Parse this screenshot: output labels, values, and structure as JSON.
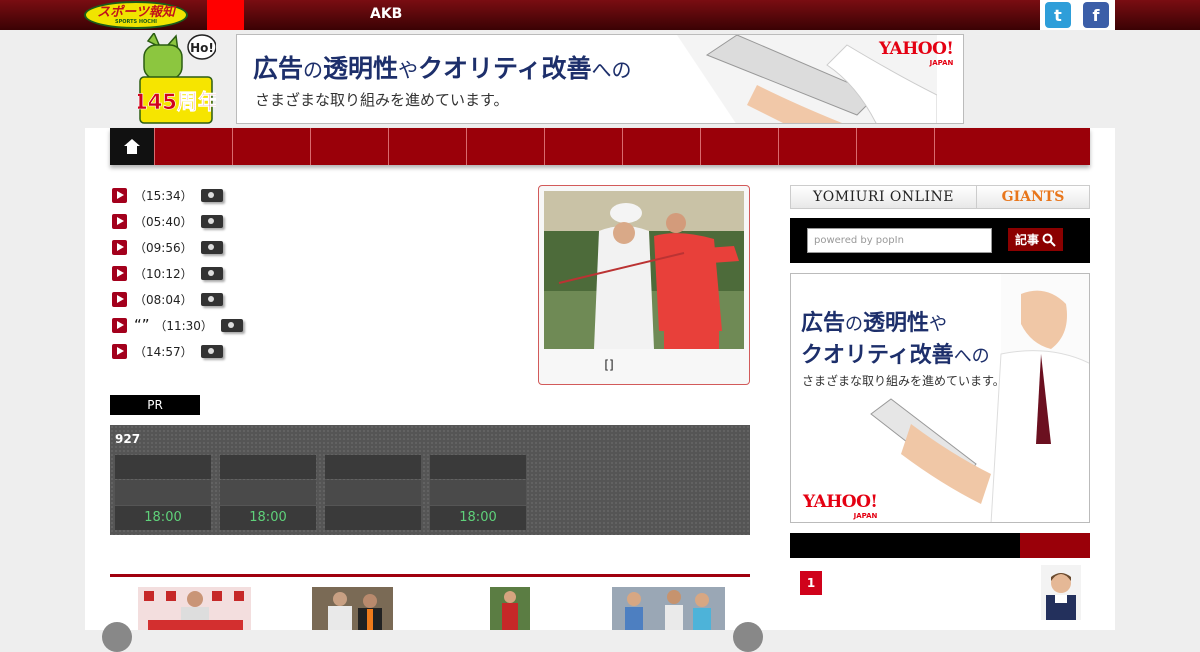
{
  "header": {
    "logo_text": "スポーツ報知",
    "logo_sub": "SPORTS HOCHI",
    "top_link": "AKB",
    "twitter_glyph": "t",
    "facebook_glyph": "f"
  },
  "mascot": {
    "badge_top": "Ho!",
    "anniversary": "145周年"
  },
  "top_banner": {
    "line1_a": "広告",
    "line1_b": "の",
    "line1_c": "透明性",
    "line1_d": "や",
    "line1_e": "クオリティ改善",
    "line1_f": "への",
    "line2": "さまざまな取り組みを進めています。",
    "brand": "YAHOO!",
    "brand_sub": "JAPAN"
  },
  "nav": {
    "home_icon": "home-icon",
    "items": [
      "",
      "",
      "",
      "",
      "",
      "",
      "",
      "",
      "",
      "",
      "",
      ""
    ],
    "item_labels": {
      "i8": "",
      "i9": ""
    },
    "i8": "",
    "i9": ""
  },
  "news": [
    {
      "title": "",
      "time": "（15:34）"
    },
    {
      "title": "",
      "time": "（05:40）"
    },
    {
      "title": "",
      "time": "（09:56）"
    },
    {
      "title": "",
      "time": "（10:12）"
    },
    {
      "title": "",
      "time": "（08:04）"
    },
    {
      "title": "“”",
      "time": "（11:30）"
    },
    {
      "title": "",
      "time": "（14:57）"
    }
  ],
  "feature": {
    "caption": "[]"
  },
  "pr": {
    "badge": "PR",
    "text": ""
  },
  "scoreboard": {
    "label": "927",
    "games": [
      {
        "time": "18:00"
      },
      {
        "time": "18:00"
      },
      {
        "time": ""
      },
      {
        "time": "18:00"
      }
    ]
  },
  "section": {
    "title": ""
  },
  "sidebar": {
    "tab1": "YOMIURI ONLINE",
    "tab2": "GIANTS",
    "search_placeholder": "powered by popIn",
    "search_button": "記事",
    "ad_line1_a": "広告",
    "ad_line1_b": "の",
    "ad_line1_c": "透明性",
    "ad_line1_d": "や",
    "ad_line2_a": "クオリティ改善",
    "ad_line2_b": "への",
    "ad_line3": "さまざまな取り組みを進めています。",
    "ad_brand": "YAHOO!",
    "ad_brand_sub": "JAPAN",
    "rank_first": "1"
  },
  "colors": {
    "brand_red": "#9a0009",
    "accent_red": "#d0021b",
    "score_green": "#5fd17a"
  }
}
